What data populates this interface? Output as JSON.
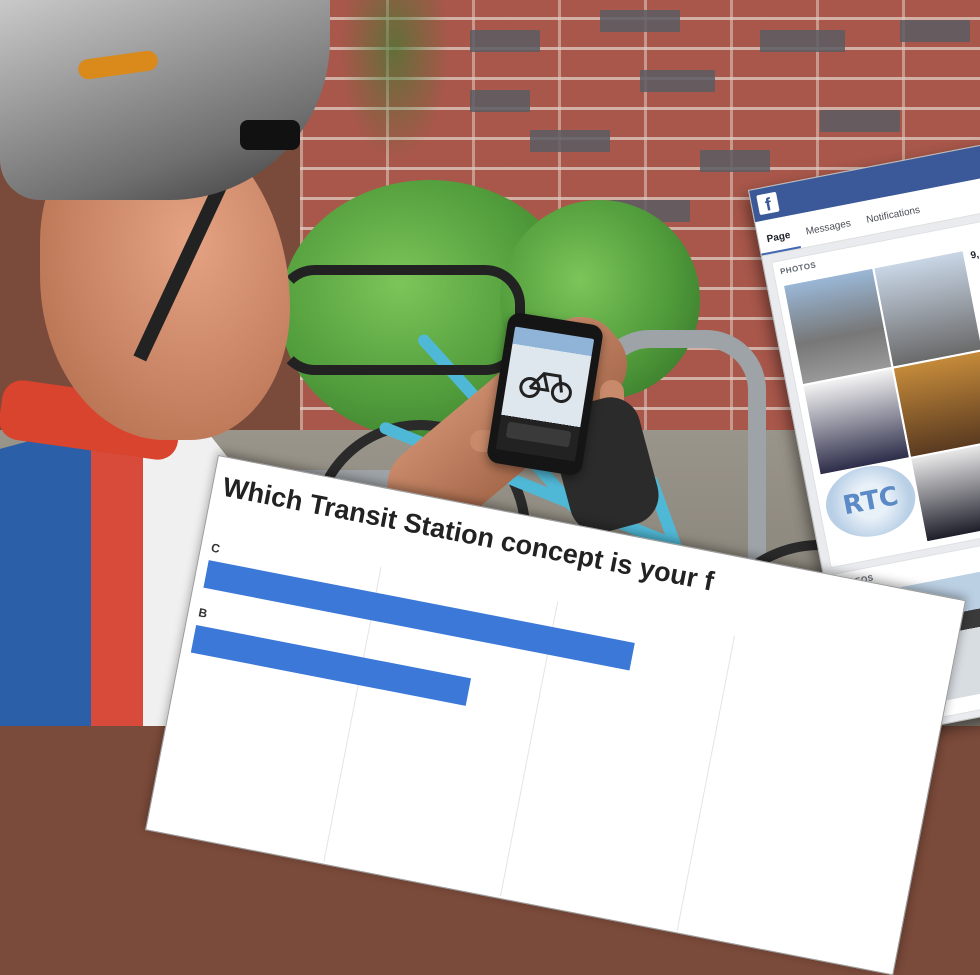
{
  "facebook": {
    "logo": "f",
    "tabs": [
      "Page",
      "Messages",
      "Notifications"
    ],
    "active_tab": "Page",
    "photos_heading": "PHOTOS",
    "videos_heading": "VIDEOS",
    "post_snippet": "9,",
    "logo_text": "RTC"
  },
  "survey": {
    "title": "Which Transit Station concept is your f",
    "rows": [
      {
        "label": "C",
        "value": 0.62
      },
      {
        "label": "B",
        "value": 0.4
      }
    ],
    "bar_color": "#3c78d8"
  },
  "colors": {
    "facebook_blue": "#3b5998",
    "brick": "#a8574a",
    "bike": "#4fb8d6"
  }
}
